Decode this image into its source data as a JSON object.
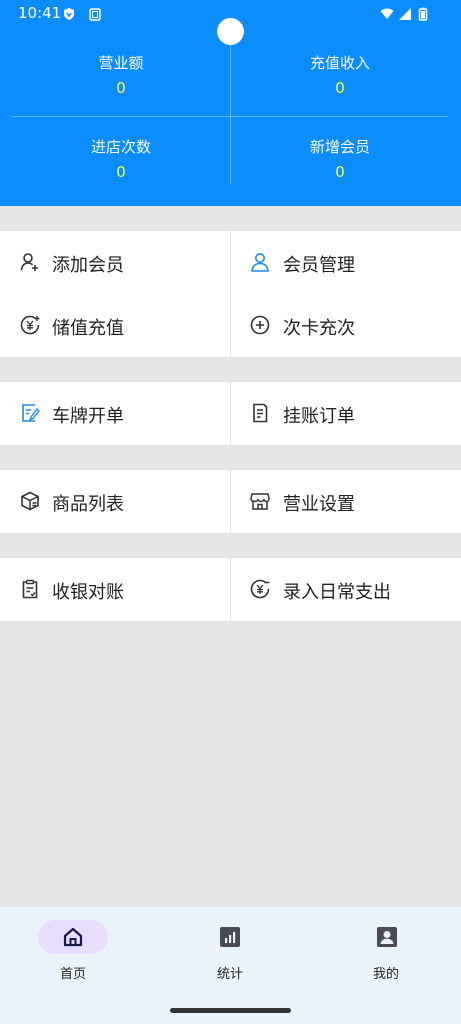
{
  "status_bar": {
    "time": "10:41"
  },
  "stats": [
    {
      "label": "营业额",
      "value": "0"
    },
    {
      "label": "充值收入",
      "value": "0"
    },
    {
      "label": "进店次数",
      "value": "0"
    },
    {
      "label": "新增会员",
      "value": "0"
    }
  ],
  "menu": {
    "add_member": "添加会员",
    "member_manage": "会员管理",
    "stored_recharge": "储值充值",
    "card_recharge": "次卡充次",
    "plate_order": "车牌开单",
    "credit_orders": "挂账订单",
    "product_list": "商品列表",
    "business_settings": "营业设置",
    "cash_reconcile": "收银对账",
    "daily_expense": "录入日常支出"
  },
  "nav": {
    "home": "首页",
    "stats": "统计",
    "mine": "我的"
  },
  "colors": {
    "header": "#0b8cff",
    "stat_value": "#f2ff3b",
    "accent_icon": "#1e88e5",
    "nav_active_pill": "#e8dcff"
  }
}
